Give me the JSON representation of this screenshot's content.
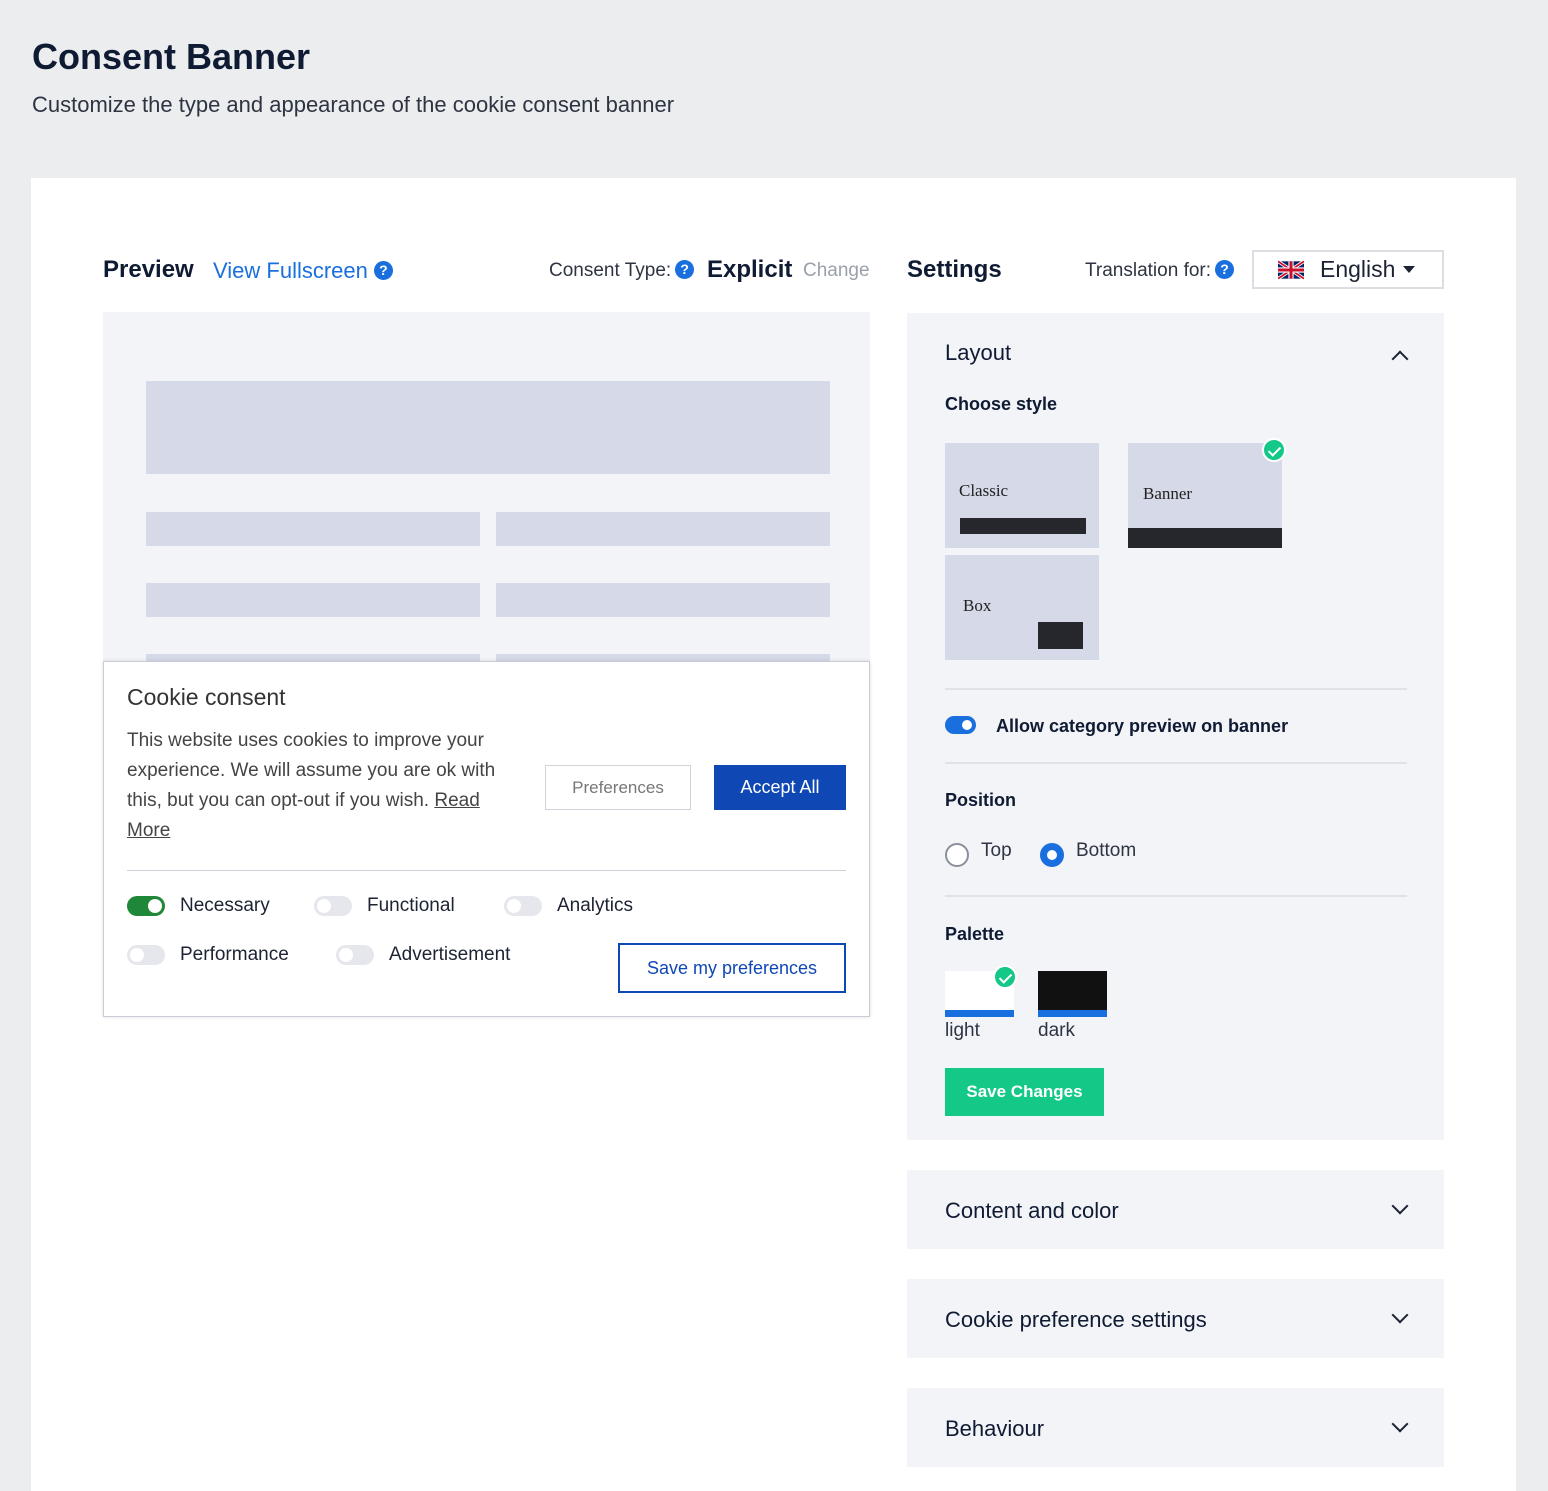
{
  "page": {
    "title": "Consent Banner",
    "subtitle": "Customize the type and appearance of the cookie consent banner"
  },
  "preview": {
    "title": "Preview",
    "fullscreen_link": "View Fullscreen",
    "consent_type_label": "Consent Type:",
    "consent_type_value": "Explicit",
    "change_link": "Change"
  },
  "banner": {
    "title": "Cookie consent",
    "text": "This website uses cookies to improve your experience. We will assume you are ok with this, but you can opt-out if you wish. ",
    "read_more": "Read More",
    "preferences_button": "Preferences",
    "accept_button": "Accept All",
    "categories": [
      {
        "label": "Necessary",
        "enabled": true
      },
      {
        "label": "Functional",
        "enabled": false
      },
      {
        "label": "Analytics",
        "enabled": false
      },
      {
        "label": "Performance",
        "enabled": false
      },
      {
        "label": "Advertisement",
        "enabled": false
      }
    ],
    "save_preferences_button": "Save my preferences"
  },
  "settings": {
    "title": "Settings",
    "translation_label": "Translation for:",
    "language": "English",
    "flag_icon": "uk-flag-icon",
    "layout": {
      "title": "Layout",
      "choose_style_label": "Choose style",
      "styles": [
        {
          "label": "Classic",
          "selected": false
        },
        {
          "label": "Banner",
          "selected": true
        },
        {
          "label": "Box",
          "selected": false
        }
      ],
      "allow_category_preview_label": "Allow category preview on banner",
      "allow_category_preview": true,
      "position_label": "Position",
      "positions": [
        {
          "label": "Top",
          "checked": false
        },
        {
          "label": "Bottom",
          "checked": true
        }
      ],
      "palette_label": "Palette",
      "palettes": [
        {
          "label": "light",
          "selected": true,
          "color": "#ffffff"
        },
        {
          "label": "dark",
          "selected": false,
          "color": "#111111"
        }
      ],
      "save_button": "Save Changes"
    },
    "sections": [
      {
        "title": "Content and color"
      },
      {
        "title": "Cookie preference settings"
      },
      {
        "title": "Behaviour"
      }
    ]
  },
  "colors": {
    "accent_blue": "#1a6fde",
    "primary_button": "#0f47b5",
    "success_green": "#14c987",
    "toggle_on": "#1e8738"
  }
}
